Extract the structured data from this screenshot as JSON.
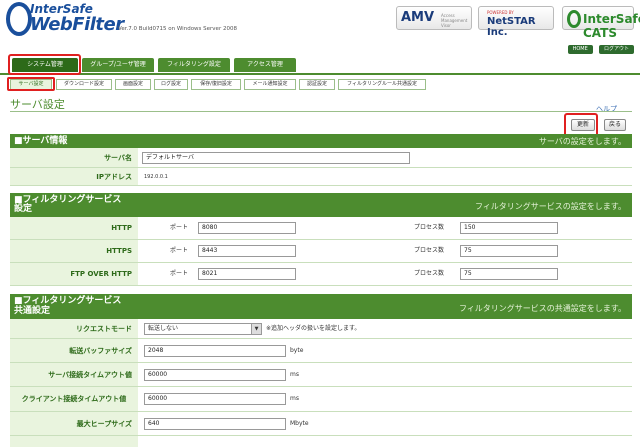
{
  "header": {
    "logo_line1": "InterSafe",
    "logo_line2": "WebFilter",
    "version": "Ver.7.0 Build0715 on Windows Server 2008",
    "brands": {
      "amv": "AMV",
      "amv_sub": "Access Management Visor",
      "netstar_top": "POWERED BY",
      "netstar": "NetSTAR Inc.",
      "cats": "InterSafe CATS"
    },
    "home": "HOME",
    "logout": "ログアウト"
  },
  "main_tabs": [
    "システム管理",
    "グループ/ユーザ管理",
    "フィルタリング設定",
    "アクセス管理"
  ],
  "sub_tabs": [
    "サーバ設定",
    "ダウンロード設定",
    "画面設定",
    "ログ設定",
    "保存/復旧設定",
    "メール通知設定",
    "認証設定",
    "フィルタリングルール共通設定"
  ],
  "page": {
    "title": "サーバ設定",
    "help": "ヘルプ",
    "update_button": "更新",
    "back_button": "戻る"
  },
  "server_info": {
    "title": "■サーバ情報",
    "desc": "サーバの設定をします。",
    "server_name_label": "サーバ名",
    "server_name_value": "デフォルトサーバ",
    "ip_label": "IPアドレス",
    "ip_value": "192.0.0.1"
  },
  "filtering_service": {
    "title_line1": "■フィルタリングサービス",
    "title_line2": "設定",
    "desc": "フィルタリングサービスの設定をします。",
    "port_label": "ポート",
    "process_label": "プロセス数",
    "rows": [
      {
        "label": "HTTP",
        "port": "8080",
        "process": "150"
      },
      {
        "label": "HTTPS",
        "port": "8443",
        "process": "75"
      },
      {
        "label": "FTP OVER HTTP",
        "port": "8021",
        "process": "75"
      }
    ]
  },
  "common_settings": {
    "title_line1": "■フィルタリングサービス",
    "title_line2": "共通設定",
    "desc": "フィルタリングサービスの共通設定をします。",
    "request_mode_label": "リクエストモード",
    "request_mode_value": "転送しない",
    "request_mode_note": "※追加ヘッダの扱いを設定します。",
    "buffer_label": "転送バッファサイズ",
    "buffer_value": "2048",
    "buffer_unit": "byte",
    "server_timeout_label": "サーバ接続タイムアウト値",
    "server_timeout_value": "60000",
    "server_timeout_unit": "ms",
    "client_timeout_label": "クライアント接続タイムアウト値",
    "client_timeout_value": "60000",
    "client_timeout_unit": "ms",
    "heap_label": "最大ヒープサイズ",
    "heap_value": "640",
    "heap_unit": "Mbyte"
  },
  "colors": {
    "accent": "#4d8c2f",
    "highlight": "#e02020"
  }
}
